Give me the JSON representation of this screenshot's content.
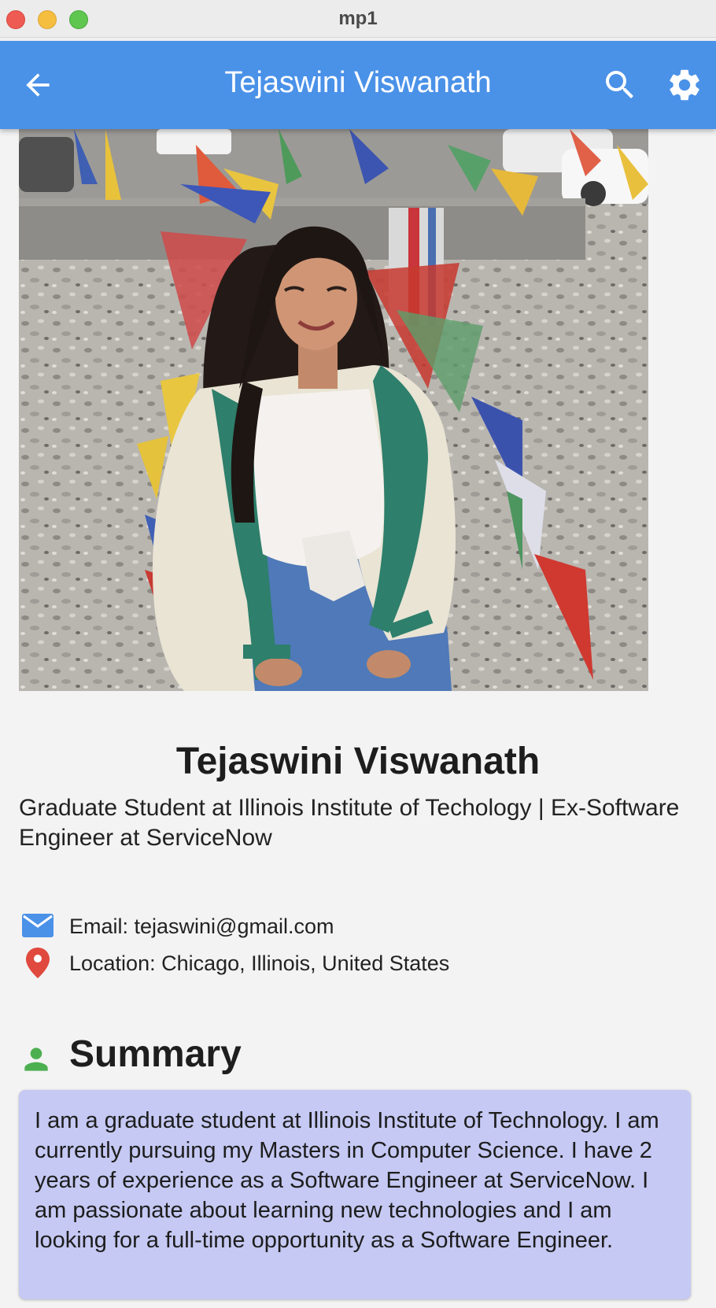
{
  "window": {
    "title": "mp1"
  },
  "appbar": {
    "title": "Tejaswini Viswanath",
    "back_icon": "arrow-back-icon",
    "search_icon": "search-icon",
    "settings_icon": "gear-icon",
    "color": "#4a91e8"
  },
  "profile": {
    "photo": "profile-photo",
    "name": "Tejaswini Viswanath",
    "headline": "Graduate Student at Illinois Institute of Techology | Ex-Software Engineer at ServiceNow"
  },
  "contact": {
    "email": "Email: tejaswini@gmail.com",
    "location": "Location: Chicago, Illinois, United States",
    "email_icon": "mail-icon",
    "location_icon": "location-pin-icon"
  },
  "summary": {
    "heading": "Summary",
    "icon": "person-icon",
    "text": "I am a graduate student at Illinois Institute of Technology. I am currently pursuing my Masters in Computer Science. I have 2 years of experience as a Software Engineer at ServiceNow. I am passionate about learning new technologies and I am looking for a full-time opportunity as a Software Engineer.",
    "card_color": "#c5c9f3"
  }
}
